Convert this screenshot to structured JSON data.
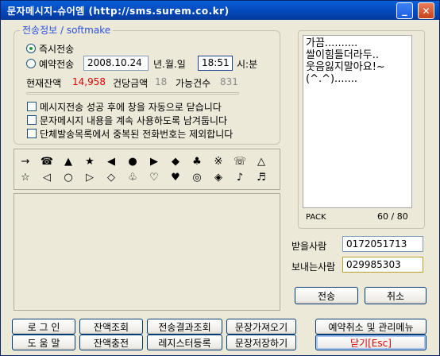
{
  "window": {
    "title": "문자메시지-슈어엠 (http://sms.surem.co.kr)"
  },
  "send_info": {
    "legend": "전송정보 / softmake",
    "immediate_label": "즉시전송",
    "reserve_label": "예약전송",
    "date_value": "2008.10.24",
    "date_unit": "년.월.일",
    "time_value": "18:51",
    "time_unit": "시:분",
    "balance_label": "현재잔액",
    "balance_value": "14,958",
    "unit_price_label": "건당금액",
    "unit_price_value": "18",
    "available_label": "가능건수",
    "available_value": "831"
  },
  "options": [
    "메시지전송 성공 후에 창을 자동으로 닫습니다",
    "문자메시지 내용을 계속 사용하도록 남겨둡니다",
    "단체발송목록에서 중복된 전화번호는 제외합니다"
  ],
  "symbols": {
    "row1": [
      "→",
      "☎",
      "▲",
      "★",
      "◀",
      "●",
      "▶",
      "◆",
      "♣",
      "※",
      "☏",
      "△"
    ],
    "row2": [
      "☆",
      "◁",
      "○",
      "▷",
      "◇",
      "♧",
      "♡",
      "♥",
      "◎",
      "◈",
      "♪",
      "♬"
    ]
  },
  "message": {
    "text": "가끔..........\n쌀이힘들더라두..\n웃음잃지말아요!~\n(^.^).......",
    "pack_label": "PACK",
    "count": "60 / 80"
  },
  "receiver": {
    "label": "받을사람",
    "value": "0172051713"
  },
  "sender": {
    "label": "보내는사람",
    "value": "029985303"
  },
  "buttons": {
    "send": "전송",
    "cancel": "취소",
    "login": "로 그 인",
    "balance_check": "잔액조회",
    "result_check": "전송결과조회",
    "load_sentence": "문장가져오기",
    "reserve_manage": "예약취소 및 관리메뉴",
    "help": "도 움 말",
    "recharge": "잔액충전",
    "registry": "레지스터등록",
    "save_sentence": "문장저장하기",
    "close": "닫기[Esc]"
  }
}
